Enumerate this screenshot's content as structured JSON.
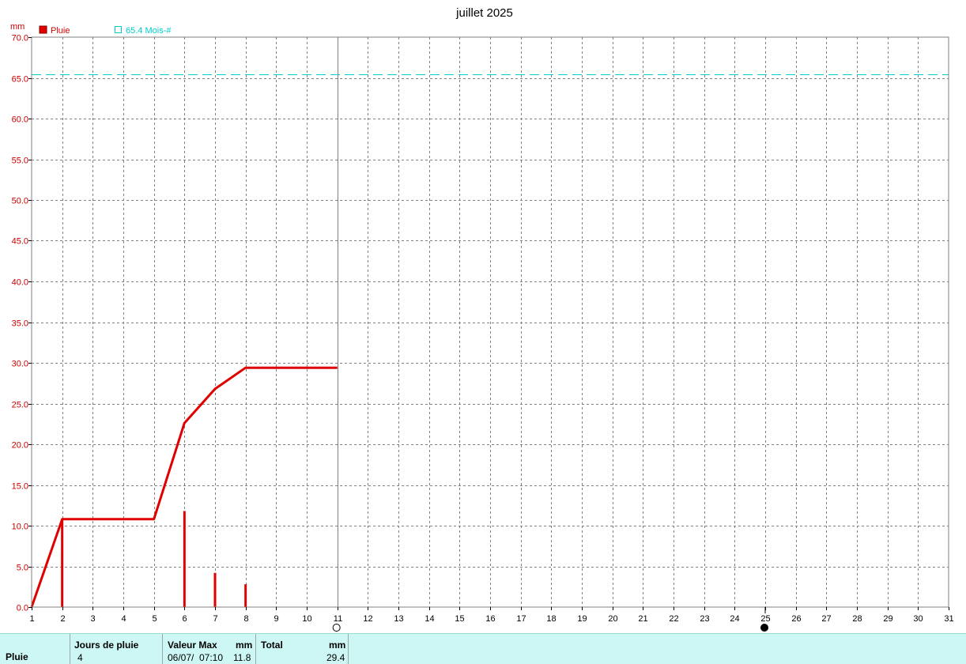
{
  "chart_data": {
    "type": "line",
    "title": "juillet 2025",
    "ylabel": "mm",
    "ylim": [
      0,
      70
    ],
    "xlim": [
      1,
      31
    ],
    "grid": true,
    "y_ticks": [
      "0.0",
      "5.0",
      "10.0",
      "15.0",
      "20.0",
      "25.0",
      "30.0",
      "35.0",
      "40.0",
      "45.0",
      "50.0",
      "55.0",
      "60.0",
      "65.0",
      "70.0"
    ],
    "x_ticks": [
      "1",
      "2",
      "3",
      "4",
      "5",
      "6",
      "7",
      "8",
      "9",
      "10",
      "11",
      "12",
      "13",
      "14",
      "15",
      "16",
      "17",
      "18",
      "19",
      "20",
      "21",
      "22",
      "23",
      "24",
      "25",
      "26",
      "27",
      "28",
      "29",
      "30",
      "31"
    ],
    "legend": {
      "placement": "top-left",
      "items": [
        {
          "name": "Pluie",
          "color": "#e00000",
          "marker": "filled-square"
        },
        {
          "name": "65.4 Mois-#",
          "color": "#00cccc",
          "marker": "open-square"
        }
      ]
    },
    "series": [
      {
        "name": "Pluie",
        "kind": "cumulative-line",
        "color": "#e00000",
        "x": [
          1,
          2,
          5,
          6,
          7,
          8,
          11
        ],
        "y": [
          0.0,
          10.8,
          10.8,
          22.6,
          26.8,
          29.4,
          29.4
        ]
      },
      {
        "name": "Pluie",
        "kind": "daily-bars",
        "color": "#e00000",
        "x": [
          2,
          6,
          7,
          8
        ],
        "y": [
          10.8,
          11.8,
          4.2,
          2.8
        ]
      },
      {
        "name": "65.4 Mois-#",
        "kind": "reference-line",
        "color": "#00cccc",
        "y": 65.4
      }
    ],
    "current_day_marker": 11,
    "moon_phases": [
      {
        "day": 11,
        "phase": "full-moon"
      },
      {
        "day": 25,
        "phase": "new-moon"
      }
    ]
  },
  "summary": {
    "row_label": "Pluie",
    "jours_header": "Jours de pluie",
    "jours_value": "4",
    "valeur_max_header": "Valeur Max",
    "valeur_max_unit": "mm",
    "valeur_max_date": "06/07/",
    "valeur_max_time": "07:10",
    "valeur_max_value": "11.8",
    "total_header": "Total",
    "total_unit": "mm",
    "total_value": "29.4"
  }
}
